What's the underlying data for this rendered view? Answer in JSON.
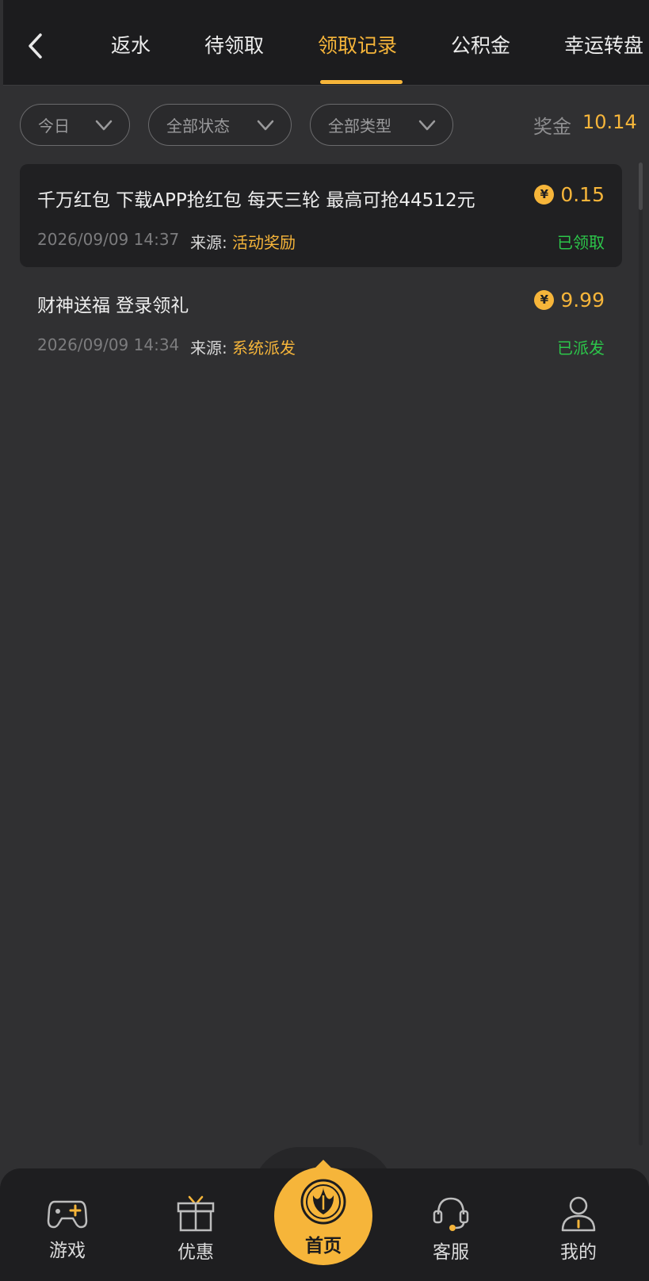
{
  "header": {
    "back_icon": "chevron-left-icon",
    "tabs": [
      {
        "label": "返水",
        "active": false
      },
      {
        "label": "待领取",
        "active": false
      },
      {
        "label": "领取记录",
        "active": true
      },
      {
        "label": "公积金",
        "active": false
      },
      {
        "label": "幸运转盘",
        "active": false
      }
    ]
  },
  "filters": {
    "date": "今日",
    "status": "全部状态",
    "type": "全部类型",
    "bonus_label": "奖金",
    "bonus_value": "10.14"
  },
  "records": [
    {
      "title": "千万红包 下载APP抢红包 每天三轮 最高可抢44512元",
      "time": "2026/09/09 14:37",
      "source_label": "来源:",
      "source": "活动奖励",
      "currency_symbol": "¥",
      "amount": "0.15",
      "status": "已领取"
    },
    {
      "title": "财神送福 登录领礼",
      "time": "2026/09/09 14:34",
      "source_label": "来源:",
      "source": "系统派发",
      "currency_symbol": "¥",
      "amount": "9.99",
      "status": "已派发"
    }
  ],
  "bottom_nav": {
    "items": [
      {
        "label": "游戏",
        "icon": "gamepad-icon"
      },
      {
        "label": "优惠",
        "icon": "gift-icon"
      },
      {
        "label": "首页",
        "icon": "home-logo-icon"
      },
      {
        "label": "客服",
        "icon": "headset-icon"
      },
      {
        "label": "我的",
        "icon": "user-icon"
      }
    ]
  },
  "colors": {
    "accent": "#f6b53a",
    "status_green": "#2cc64a",
    "background": "#303032",
    "card": "#202022"
  }
}
